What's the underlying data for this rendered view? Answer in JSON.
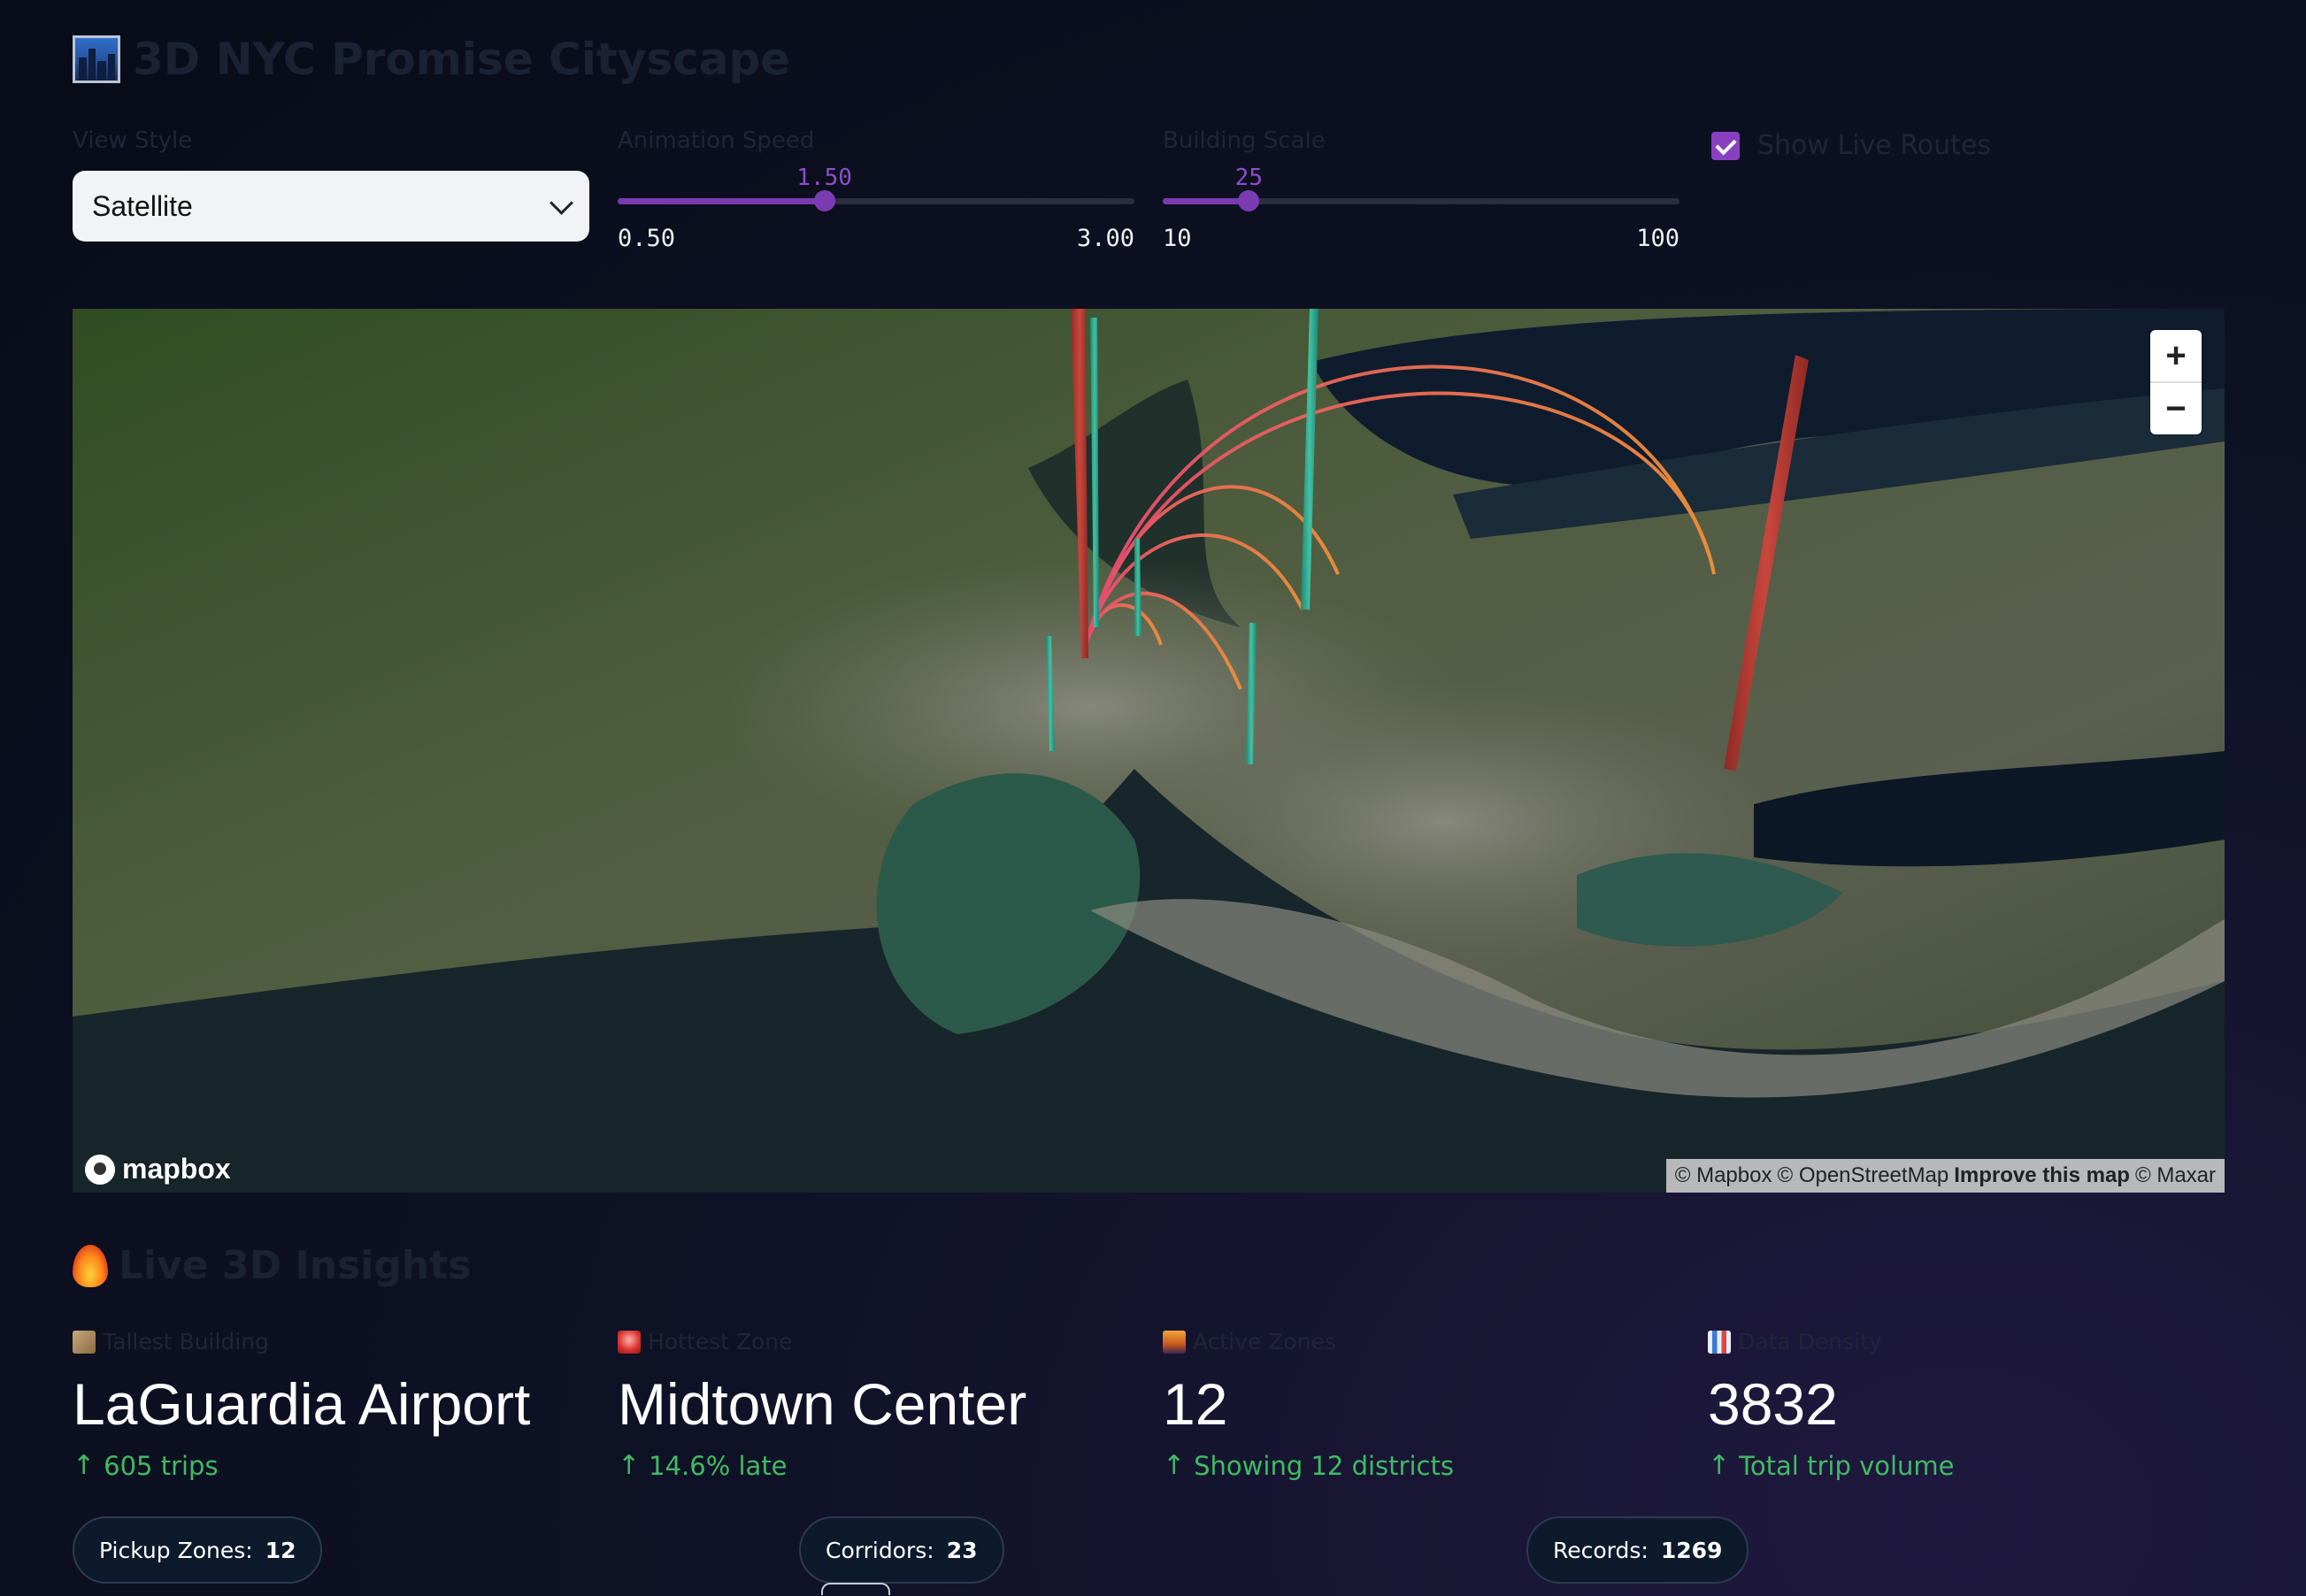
{
  "app": {
    "title": "3D NYC Promise Cityscape"
  },
  "controls": {
    "view_style": {
      "label": "View Style",
      "value": "Satellite"
    },
    "animation_speed": {
      "label": "Animation Speed",
      "value": 1.5,
      "value_text": "1.50",
      "min": "0.50",
      "max": "3.00"
    },
    "building_scale": {
      "label": "Building Scale",
      "value": 25,
      "value_text": "25",
      "min": "10",
      "max": "100"
    },
    "show_live_routes": {
      "label": "Show Live Routes",
      "checked": true
    }
  },
  "map": {
    "zoom_in": "+",
    "zoom_out": "−",
    "logo": "mapbox",
    "attribution": {
      "mapbox": "© Mapbox",
      "osm": "© OpenStreetMap",
      "improve": "Improve this map",
      "maxar": "© Maxar"
    },
    "colors": {
      "building_red": "#c6453c",
      "building_teal": "#39b59a",
      "route_pink": "#ea4a72",
      "route_orange": "#f08a3a"
    }
  },
  "insights": {
    "title": "Live 3D Insights",
    "metrics": [
      {
        "label": "Tallest Building",
        "icon": "construction-icon",
        "value": "LaGuardia Airport",
        "delta": "605 trips"
      },
      {
        "label": "Hottest Zone",
        "icon": "siren-icon",
        "value": "Midtown Center",
        "delta": "14.6% late"
      },
      {
        "label": "Active Zones",
        "icon": "cityscape-icon",
        "value": "12",
        "delta": "Showing 12 districts"
      },
      {
        "label": "Data Density",
        "icon": "bar-chart-icon",
        "value": "3832",
        "delta": "Total trip volume"
      }
    ],
    "pills": [
      {
        "label": "Pickup Zones:",
        "value": "12"
      },
      {
        "label": "Corridors:",
        "value": "23"
      },
      {
        "label": "Records:",
        "value": "1269"
      }
    ]
  }
}
